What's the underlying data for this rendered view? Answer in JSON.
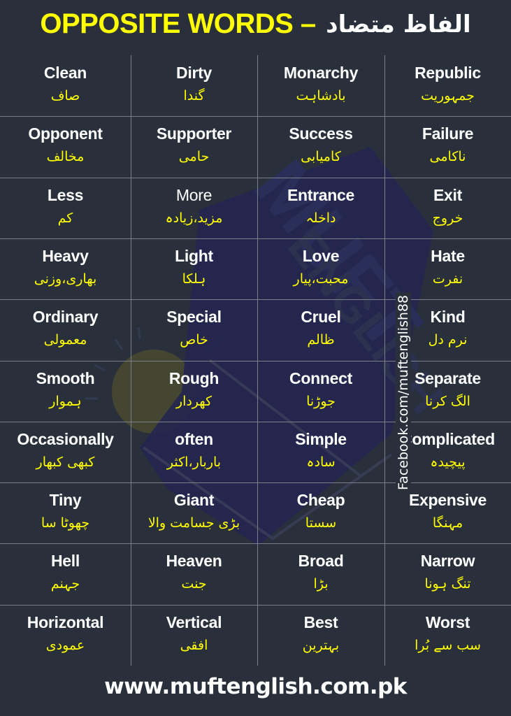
{
  "header": {
    "title_en": "OPPOSITE WORDS –",
    "title_ur": "الفاظ متضاد"
  },
  "watermark": {
    "brand": "MUFT ENGLISH",
    "colors": {
      "dark_blue": "#232650",
      "olive": "#4a4a30"
    }
  },
  "colors": {
    "background": "#29303b",
    "english_text": "#ffffff",
    "urdu_text": "#ffff00",
    "title_text": "#ffff00",
    "grid_lines": "#7a7f88"
  },
  "rows": [
    {
      "cells": [
        {
          "en": "Clean",
          "ur": "صاف"
        },
        {
          "en": "Dirty",
          "ur": "گندا"
        },
        {
          "en": "Monarchy",
          "ur": "بادشاہت"
        },
        {
          "en": "Republic",
          "ur": "جمہوریت"
        }
      ]
    },
    {
      "cells": [
        {
          "en": "Opponent",
          "ur": "مخالف"
        },
        {
          "en": "Supporter",
          "ur": "حامی"
        },
        {
          "en": "Success",
          "ur": "کامیابی"
        },
        {
          "en": "Failure",
          "ur": "ناکامی"
        }
      ]
    },
    {
      "cells": [
        {
          "en": "Less",
          "ur": "کم"
        },
        {
          "en": "More",
          "ur": "مزید،زیادہ"
        },
        {
          "en": "Entrance",
          "ur": "داخلہ"
        },
        {
          "en": "Exit",
          "ur": "خروج"
        }
      ]
    },
    {
      "cells": [
        {
          "en": "Heavy",
          "ur": "بھاری،وزنی"
        },
        {
          "en": "Light",
          "ur": "ہلکا"
        },
        {
          "en": "Love",
          "ur": "محبت،پیار"
        },
        {
          "en": "Hate",
          "ur": "نفرت"
        }
      ]
    },
    {
      "cells": [
        {
          "en": "Ordinary",
          "ur": "معمولی"
        },
        {
          "en": "Special",
          "ur": "خاص"
        },
        {
          "en": "Cruel",
          "ur": "ظالم"
        },
        {
          "en": "Kind",
          "ur": "نرم دل"
        }
      ]
    },
    {
      "cells": [
        {
          "en": "Smooth",
          "ur": "ہموار"
        },
        {
          "en": "Rough",
          "ur": "کھردار"
        },
        {
          "en": "Connect",
          "ur": "جوڑنا"
        },
        {
          "en": "Separate",
          "ur": "الگ کرنا"
        }
      ]
    },
    {
      "cells": [
        {
          "en": "Occasionally",
          "ur": "کبھی کبھار"
        },
        {
          "en": "often",
          "ur": "باربار،اکثر"
        },
        {
          "en": "Simple",
          "ur": "سادہ"
        },
        {
          "en": "Complicated",
          "ur": "پیچیدہ"
        }
      ]
    },
    {
      "cells": [
        {
          "en": "Tiny",
          "ur": "چھوٹا سا"
        },
        {
          "en": "Giant",
          "ur": "بڑی جسامت والا"
        },
        {
          "en": "Cheap",
          "ur": "سستا"
        },
        {
          "en": "Expensive",
          "ur": "مہنگا"
        }
      ]
    },
    {
      "cells": [
        {
          "en": "Hell",
          "ur": "جہنم"
        },
        {
          "en": "Heaven",
          "ur": "جنت"
        },
        {
          "en": "Broad",
          "ur": "بڑا"
        },
        {
          "en": "Narrow",
          "ur": "تنگ ہونا"
        }
      ]
    },
    {
      "cells": [
        {
          "en": "Horizontal",
          "ur": "عمودی"
        },
        {
          "en": "Vertical",
          "ur": "افقی"
        },
        {
          "en": "Best",
          "ur": "بہترین"
        },
        {
          "en": "Worst",
          "ur": "سب سے بُرا"
        }
      ]
    }
  ],
  "side_label": "Facebook.com/muftenglish88",
  "footer": {
    "url": "www.muftenglish.com.pk"
  }
}
